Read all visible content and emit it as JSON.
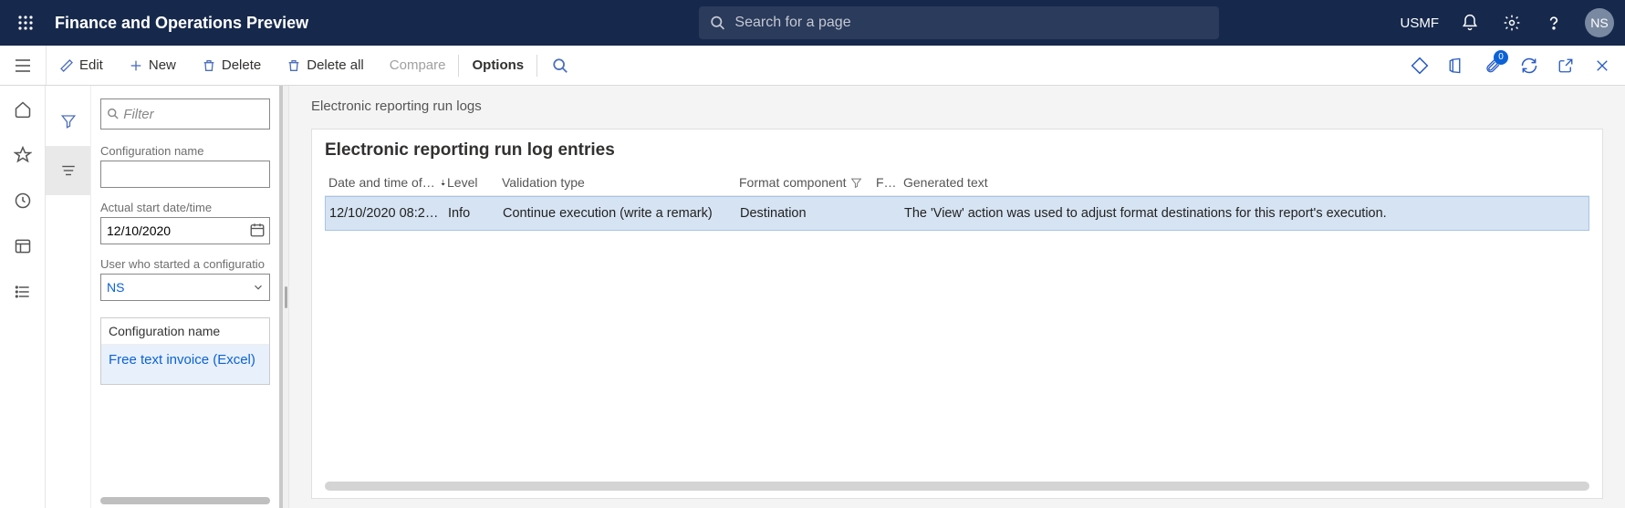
{
  "topbar": {
    "app_title": "Finance and Operations Preview",
    "search_placeholder": "Search for a page",
    "company": "USMF",
    "avatar_initials": "NS"
  },
  "actionbar": {
    "edit": "Edit",
    "new": "New",
    "delete": "Delete",
    "delete_all": "Delete all",
    "compare": "Compare",
    "options": "Options",
    "attach_badge": "0"
  },
  "filterpanel": {
    "filter_placeholder": "Filter",
    "config_name_label": "Configuration name",
    "config_name_value": "",
    "start_dt_label": "Actual start date/time",
    "start_dt_value": "12/10/2020",
    "user_label": "User who started a configuration run",
    "user_value": "NS",
    "list_header": "Configuration name",
    "list_item0": "Free text invoice (Excel)"
  },
  "main": {
    "breadcrumb": "Electronic reporting run logs",
    "card_title": "Electronic reporting run log entries",
    "columns": {
      "date": "Date and time of…",
      "level": "Level",
      "vtype": "Validation type",
      "fcomp": "Format component",
      "fdots": "F…",
      "gtext": "Generated text"
    },
    "rows": [
      {
        "date": "12/10/2020 08:2…",
        "level": "Info",
        "vtype": "Continue execution (write a remark)",
        "fcomp": "Destination",
        "fdots": "",
        "gtext": "The 'View' action was used to adjust format destinations for this report's execution."
      }
    ]
  }
}
